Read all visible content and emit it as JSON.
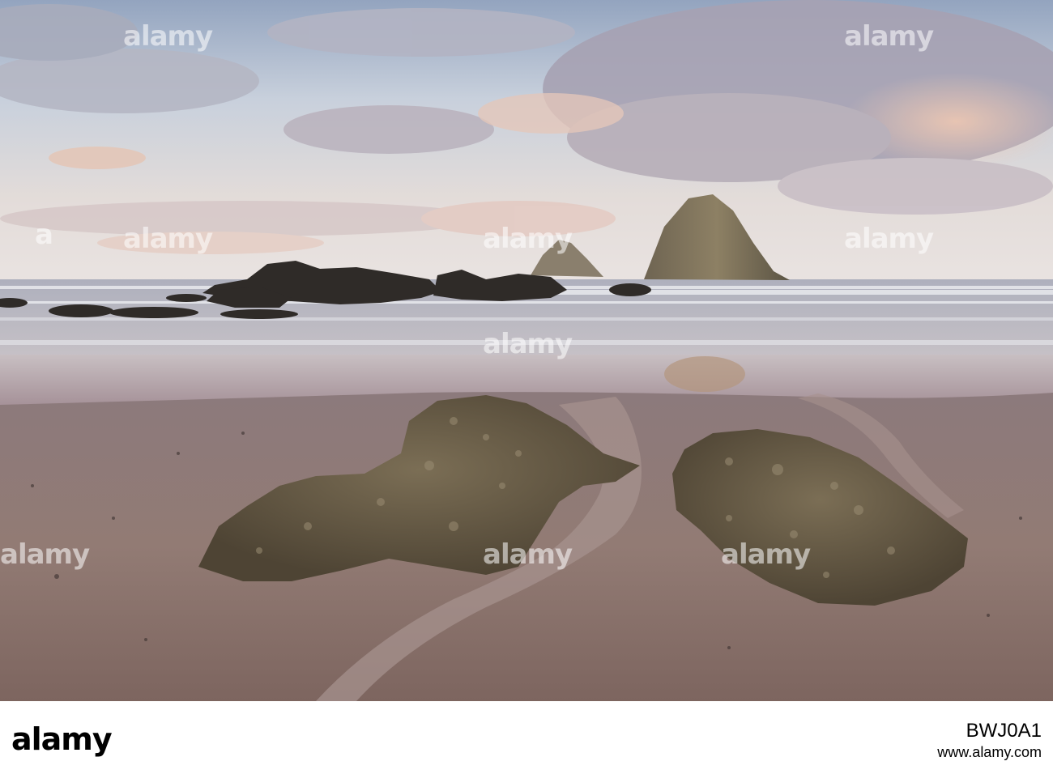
{
  "photo": {
    "subject": "coastal-sea-stacks-at-sunset"
  },
  "watermark": {
    "text": "alamy"
  },
  "footer": {
    "logo": "alamy",
    "domain": "www.alamy.com",
    "image_id": "BWJ0A1"
  },
  "colors": {
    "sky_top": "#aab6c8",
    "sky_mid": "#d9dde4",
    "cloud_warm": "#e7b9a4",
    "sea": "#b9b9c2",
    "sand": "#8e7670",
    "rock": "#5e5240"
  }
}
